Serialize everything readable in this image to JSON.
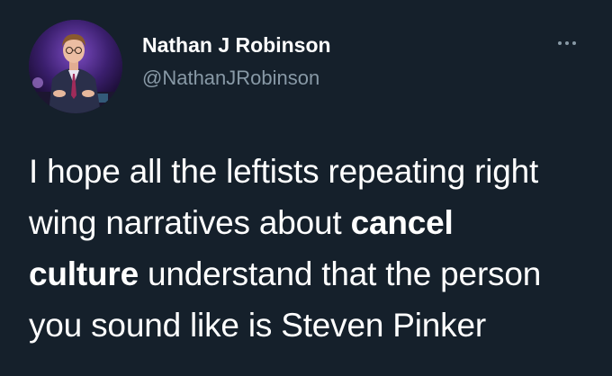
{
  "tweet": {
    "author": {
      "display_name": "Nathan J Robinson",
      "handle": "@NathanJRobinson",
      "avatar_icon": "profile-photo"
    },
    "more_icon": "ellipsis-icon",
    "text_lines": [
      {
        "segments": [
          {
            "text": "I hope all the leftists repeating right",
            "bold": false
          }
        ]
      },
      {
        "segments": [
          {
            "text": "wing narratives about ",
            "bold": false
          },
          {
            "text": "cancel",
            "bold": true
          }
        ]
      },
      {
        "segments": [
          {
            "text": "culture",
            "bold": true
          },
          {
            "text": " understand that the person",
            "bold": false
          }
        ]
      },
      {
        "segments": [
          {
            "text": "you sound like is Steven Pinker",
            "bold": false
          }
        ]
      }
    ]
  },
  "colors": {
    "background": "#15202b",
    "text_primary": "#ffffff",
    "text_secondary": "#8899a6"
  }
}
